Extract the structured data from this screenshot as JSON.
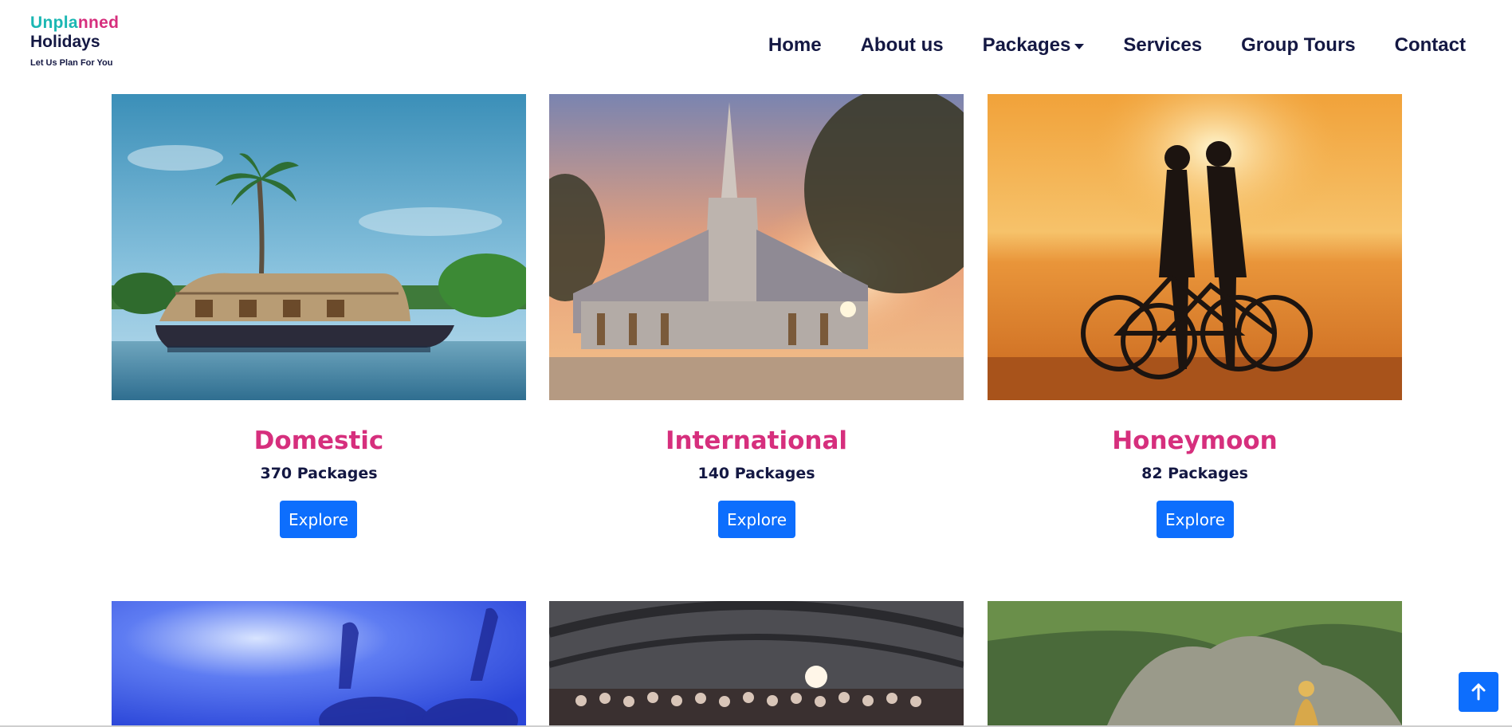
{
  "logo": {
    "line1_parts": [
      "Unpl",
      "a",
      "nned"
    ],
    "line1_colors": [
      "#1bb7b3",
      "#d62f7d",
      "#d62f7d"
    ],
    "line2": "Holidays",
    "tagline": "Let Us Plan For You"
  },
  "nav": {
    "items": [
      {
        "label": "Home"
      },
      {
        "label": "About us"
      },
      {
        "label": "Packages"
      },
      {
        "label": "Services"
      },
      {
        "label": "Group Tours"
      },
      {
        "label": "Contact"
      }
    ]
  },
  "cards": [
    {
      "title": "Domestic",
      "count": "370 Packages",
      "button": "Explore",
      "image": "houseboat-palm-photo"
    },
    {
      "title": "International",
      "count": "140 Packages",
      "button": "Explore",
      "image": "temple-sunset-photo"
    },
    {
      "title": "Honeymoon",
      "count": "82 Packages",
      "button": "Explore",
      "image": "couple-bicycles-sunset-photo"
    }
  ],
  "lower_cards": [
    {
      "image": "concert-crowd-photo"
    },
    {
      "image": "group-event-photo"
    },
    {
      "image": "cliff-statue-photo"
    }
  ],
  "colors": {
    "accent": "#d62f7d",
    "teal": "#1bb7b3",
    "navy": "#141843",
    "button": "#0d6efd"
  },
  "icons": {
    "scroll_top": "arrow-up-icon",
    "dropdown": "caret-down-icon"
  }
}
